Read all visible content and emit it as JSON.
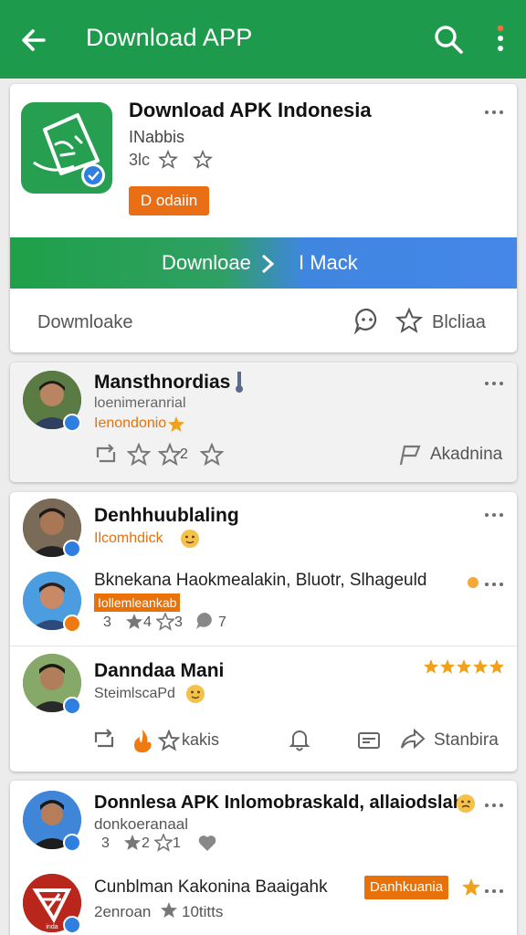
{
  "appbar": {
    "title": "Download APP",
    "back_icon": "arrow-left-icon",
    "search_icon": "search-icon",
    "menu_icon": "more-vert-icon",
    "color": "#1e9a4c"
  },
  "app_card": {
    "name": "Download APK Indonesia",
    "developer": "INabbis",
    "rating_text": "3lc",
    "badge_button": "D odaiin",
    "download_label": "Downloae",
    "mark_label": "I Mack",
    "footer_left": "Dowmloake",
    "footer_right": "Blcliaa"
  },
  "posts": [
    {
      "name": "Mansthnordias",
      "meta": "loenimeranrial",
      "tag": "Ienondonio",
      "count": "2",
      "action": "Akadnina"
    },
    {
      "name": "Denhhuublaling",
      "tag": "Ilcomhdick"
    },
    {
      "name": "Bknekana Haokmealakin, Bluotr, Slhageuld",
      "tag": "Iollemleankab",
      "stat1": "3",
      "stat2": "4",
      "stat3": "3",
      "stat4": "7"
    },
    {
      "name": "Danndaa Mani",
      "meta": "SteimlscaPd",
      "action1": "kakis",
      "action2": "Stanbira"
    },
    {
      "name": "Donnlesa APK Inlomobraskald, allaiodslah",
      "meta": "donkoeranaal",
      "stat1": "3",
      "stat2": "2",
      "stat3": "1"
    },
    {
      "name": "Cunblman Kakonina Baaigahk",
      "tag": "Danhkuania",
      "meta": "2enroan",
      "stat": "10titts"
    }
  ],
  "colors": {
    "accent_green": "#1e9a4c",
    "accent_orange": "#e8710a",
    "accent_blue": "#2f7fe0",
    "star_gold": "#f0a21c"
  }
}
